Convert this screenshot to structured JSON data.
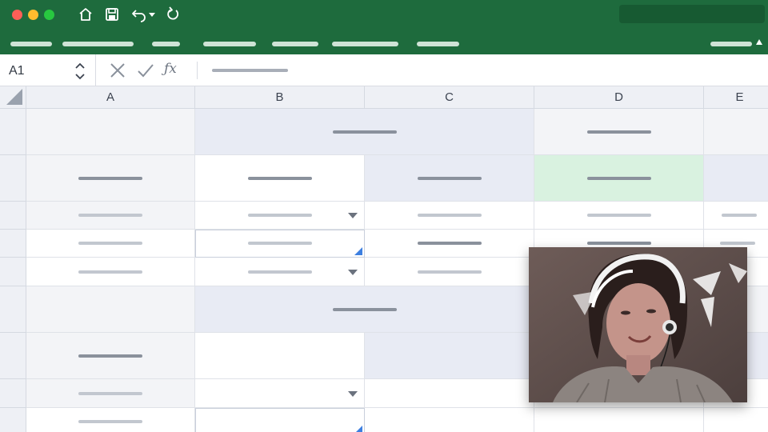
{
  "window": {
    "colors": {
      "titlebar": "#1e6b3d",
      "accent_select": "#3d7fe0",
      "highlight_green": "#d9f2e0"
    },
    "toolbar_icons": [
      "home-icon",
      "save-icon",
      "undo-icon",
      "chevron-down-icon",
      "redo-icon"
    ]
  },
  "formula_bar": {
    "cell_ref": "A1",
    "cancel_icon": "close-icon",
    "enter_icon": "check-icon",
    "function_label": "ƒx"
  },
  "sheet": {
    "columns": [
      "A",
      "B",
      "C",
      "D",
      "E"
    ]
  },
  "video_overlay": {
    "subject": "webcam-feed"
  }
}
